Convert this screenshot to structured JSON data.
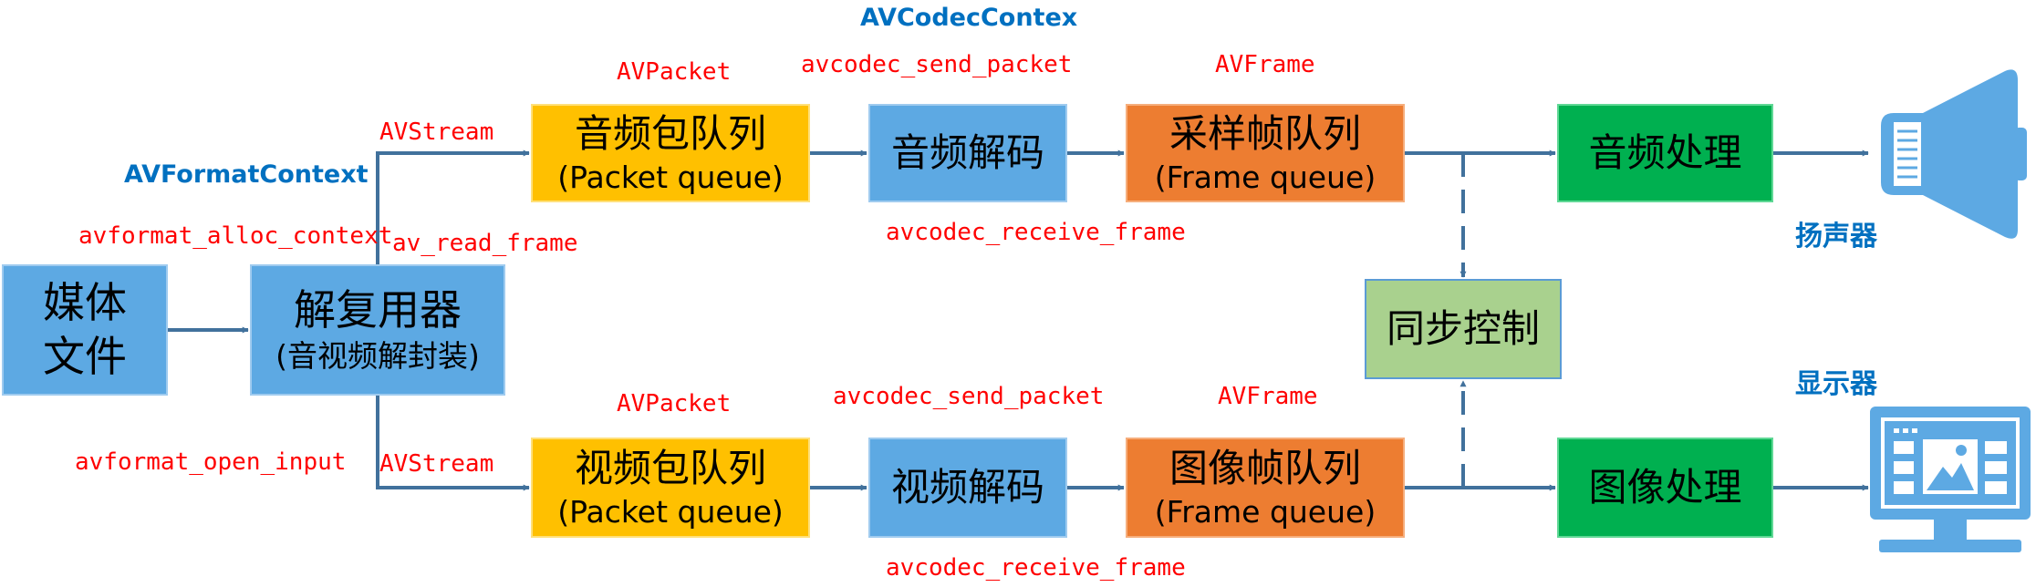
{
  "boxes": {
    "media_file": {
      "line1": "媒体",
      "line2": "文件"
    },
    "demuxer": {
      "title": "解复用器",
      "subtitle": "(音视频解封装)"
    },
    "audio_packet_queue": {
      "title": "音频包队列",
      "subtitle": "(Packet queue)"
    },
    "audio_decode": {
      "title": "音频解码"
    },
    "sample_frame_queue": {
      "title": "采样帧队列",
      "subtitle": "(Frame queue)"
    },
    "audio_process": {
      "title": "音频处理"
    },
    "sync_control": {
      "title": "同步控制"
    },
    "video_packet_queue": {
      "title": "视频包队列",
      "subtitle": "(Packet queue)"
    },
    "video_decode": {
      "title": "视频解码"
    },
    "image_frame_queue": {
      "title": "图像帧队列",
      "subtitle": "(Frame queue)"
    },
    "image_process": {
      "title": "图像处理"
    }
  },
  "labels": {
    "avcodec_context": "AVCodecContex",
    "avformat_context": "AVFormatContext",
    "avformat_alloc_context": "avformat_alloc_context",
    "av_read_frame": "av_read_frame",
    "avformat_open_input": "avformat_open_input",
    "audio_avstream": "AVStream",
    "video_avstream": "AVStream",
    "audio_avpacket": "AVPacket",
    "video_avpacket": "AVPacket",
    "audio_send_packet": "avcodec_send_packet",
    "video_send_packet": "avcodec_send_packet",
    "audio_avframe": "AVFrame",
    "video_avframe": "AVFrame",
    "audio_receive_frame": "avcodec_receive_frame",
    "video_receive_frame": "avcodec_receive_frame",
    "speaker": "扬声器",
    "display": "显示器"
  },
  "colors": {
    "blue_box": "#5da9e3",
    "yellow_box": "#ffc000",
    "orange_box": "#ed7d31",
    "green_box": "#00b050",
    "light_green_box": "#a9d18e",
    "arrow": "#41719c",
    "red_label": "#ff0000",
    "blue_label": "#0070c0"
  },
  "icons": {
    "speaker": "speaker-icon",
    "display": "monitor-icon"
  }
}
